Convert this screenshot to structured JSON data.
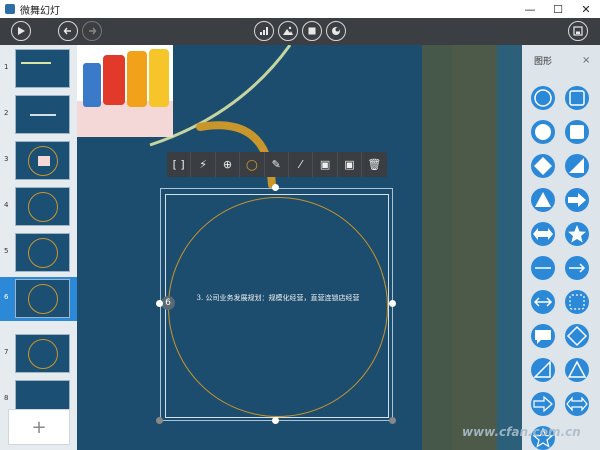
{
  "app": {
    "title": "微舞幻灯"
  },
  "window": {
    "minimize": "—",
    "maximize": "☐",
    "close": "✕"
  },
  "toolbar": {
    "left": [
      "play",
      "undo",
      "redo"
    ],
    "center": [
      "chart",
      "image",
      "stop",
      "theme"
    ],
    "right": [
      "save"
    ]
  },
  "thumbnails": [
    {
      "num": "1"
    },
    {
      "num": "2"
    },
    {
      "num": "3"
    },
    {
      "num": "4"
    },
    {
      "num": "5"
    },
    {
      "num": "6"
    },
    {
      "num": "7"
    },
    {
      "num": "8"
    }
  ],
  "selected_slide": "6",
  "add_slide": "+",
  "float_toolbar": [
    "[ ]",
    "⚡",
    "⊕",
    "○",
    "✎",
    "⁄",
    "▣",
    "▣",
    "🗑"
  ],
  "canvas": {
    "text": "3. 公司业务发展规划：规模化经营，直营连锁店经营",
    "badge": "6"
  },
  "shapes_panel": {
    "title": "图形",
    "close": "×"
  },
  "watermark": "www.cfan.com.cn",
  "colors": {
    "accent": "#2c89d8",
    "slide_bg": "#1a4a6a",
    "ring": "#c8962a",
    "panel": "#dde4ea"
  }
}
